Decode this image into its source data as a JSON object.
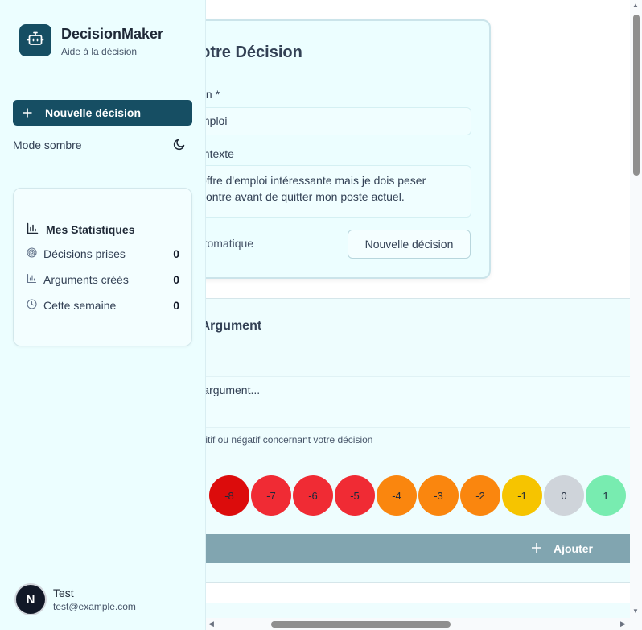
{
  "app": {
    "title": "DecisionMaker",
    "subtitle": "Aide à la décision"
  },
  "sidebar": {
    "new_decision_label": "Nouvelle décision",
    "dark_mode_label": "Mode sombre",
    "stats": {
      "title": "Mes Statistiques",
      "items": [
        {
          "label": "Décisions prises",
          "value": "0",
          "icon": "target-icon"
        },
        {
          "label": "Arguments créés",
          "value": "0",
          "icon": "bar-chart-icon"
        },
        {
          "label": "Cette semaine",
          "value": "0",
          "icon": "clock-icon"
        }
      ]
    },
    "user": {
      "initial": "N",
      "name": "Test",
      "email": "test@example.com"
    }
  },
  "decision": {
    "title": "votre Décision",
    "title_label": "sion *",
    "title_value": "mploi",
    "context_label": "contexte",
    "context_value": "offre d'emploi intéressante mais je dois peser\ncontre avant de quitter mon poste actuel.",
    "auto_label": "automatique",
    "new_button_label": "Nouvelle décision"
  },
  "argument": {
    "title": "n Argument",
    "placeholder": "re argument...",
    "help": "positif ou négatif concernant votre décision",
    "weight_label": ")",
    "scores": [
      {
        "value": "-8",
        "color": "#dc0c0c"
      },
      {
        "value": "-7",
        "color": "#f02b34"
      },
      {
        "value": "-6",
        "color": "#f02b34"
      },
      {
        "value": "-5",
        "color": "#f02b34"
      },
      {
        "value": "-4",
        "color": "#fa860e"
      },
      {
        "value": "-3",
        "color": "#fa860e"
      },
      {
        "value": "-2",
        "color": "#fa860e"
      },
      {
        "value": "-1",
        "color": "#f6c400"
      },
      {
        "value": "0",
        "color": "#cfd4da"
      },
      {
        "value": "1",
        "color": "#78ecb0"
      }
    ],
    "add_label": "Ajouter"
  }
}
